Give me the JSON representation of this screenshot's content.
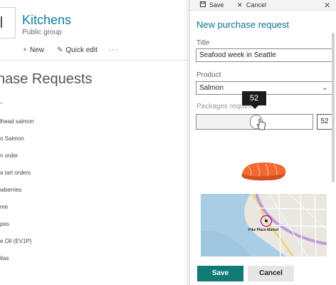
{
  "site": {
    "title": "Kitchens",
    "subtitle": "Public group"
  },
  "command_bar": {
    "new_label": "New",
    "quick_edit_label": "Quick edit",
    "more_label": "···"
  },
  "list": {
    "title": "hase Requests",
    "items": [
      "lhead salmon",
      "o Salmon",
      "n order",
      "a tart orders",
      "wberries",
      "me",
      "pes",
      "e Oil (EV1P)",
      "itas"
    ]
  },
  "panel_toolbar": {
    "save_label": "Save",
    "cancel_label": "Cancel"
  },
  "form": {
    "title": "New purchase request",
    "title_field": {
      "label": "Title",
      "value": "Seafood week in Seattle"
    },
    "product_field": {
      "label": "Product",
      "value": "Salmon"
    },
    "packages_field": {
      "label": "Packages reques",
      "value": 52,
      "value_text": "52",
      "tooltip": "52",
      "max": 100
    },
    "map": {
      "label": "Pike Place Market"
    },
    "save_label": "Save",
    "cancel_label": "Cancel"
  },
  "colors": {
    "accent": "#0e7490",
    "save_button": "#127a75",
    "tooltip": "#1c1c1c"
  }
}
